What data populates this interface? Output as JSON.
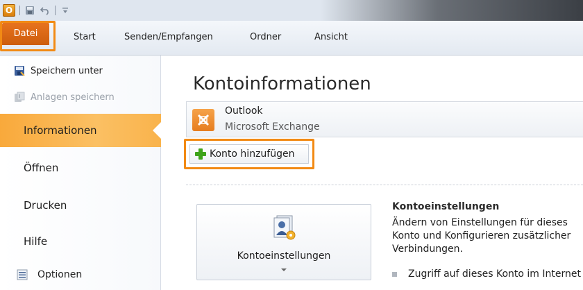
{
  "titlebar": {
    "app_icon_letter": "O",
    "icons": [
      "outlook-app-icon",
      "save-icon",
      "undo-icon",
      "customize-qat-icon"
    ]
  },
  "ribbon": {
    "tabs": [
      {
        "label": "Datei",
        "active": true
      },
      {
        "label": "Start"
      },
      {
        "label": "Senden/Empfangen"
      },
      {
        "label": "Ordner"
      },
      {
        "label": "Ansicht"
      }
    ]
  },
  "backstage": {
    "commands": [
      {
        "label": "Speichern unter",
        "enabled": true
      },
      {
        "label": "Anlagen speichern",
        "enabled": false
      }
    ],
    "nav": [
      {
        "label": "Informationen",
        "active": true
      },
      {
        "label": "Öffnen"
      },
      {
        "label": "Drucken"
      },
      {
        "label": "Hilfe"
      }
    ],
    "options_label": "Optionen"
  },
  "main": {
    "title": "Kontoinformationen",
    "account": {
      "name": "Outlook",
      "type": "Microsoft Exchange"
    },
    "add_account_label": "Konto hinzufügen",
    "settings_button_label": "Kontoeinstellungen",
    "settings_title": "Kontoeinstellungen",
    "settings_text": "Ändern von Einstellungen für dieses Konto und Konfigurieren zusätzlicher Verbindungen.",
    "settings_bullet": "Zugriff auf dieses Konto im Internet"
  },
  "colors": {
    "highlight_orange": "#f28a14",
    "datei_tab": "#e06a14",
    "active_nav": "#fbb453",
    "plus_green": "#3ea31a"
  }
}
